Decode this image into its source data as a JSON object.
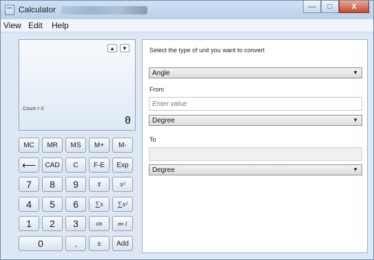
{
  "window": {
    "title": "Calculator",
    "minimize_icon": "minimize-icon",
    "maximize_icon": "maximize-icon",
    "close_icon": "close-icon",
    "minimize_glyph": "—",
    "maximize_glyph": "□",
    "close_glyph": "X"
  },
  "menu": {
    "view": "View",
    "edit": "Edit",
    "help": "Help"
  },
  "display": {
    "count": "Count = 0",
    "value": "0",
    "up_glyph": "▲",
    "down_glyph": "▼"
  },
  "keys": {
    "mc": "MC",
    "mr": "MR",
    "ms": "MS",
    "mplus": "M+",
    "mminus": "M-",
    "backspace": "⟵",
    "cad": "CAD",
    "c": "C",
    "fe": "F-E",
    "exp": "Exp",
    "seven": "7",
    "eight": "8",
    "nine": "9",
    "mean": "x̄",
    "meansq": "x²",
    "four": "4",
    "five": "5",
    "six": "6",
    "sumx": "∑x",
    "sumx2": "∑x²",
    "one": "1",
    "two": "2",
    "three": "3",
    "sigman": "σn",
    "sigman1": "σn-1",
    "zero": "0",
    "dot": ".",
    "plusminus": "±",
    "add": "Add"
  },
  "converter": {
    "prompt": "Select the type of unit you want to convert",
    "type_value": "Angle",
    "from_label": "From",
    "from_placeholder": "Enter value",
    "from_unit": "Degree",
    "to_label": "To",
    "to_value": "",
    "to_unit": "Degree",
    "dropdown_glyph": "▼"
  }
}
